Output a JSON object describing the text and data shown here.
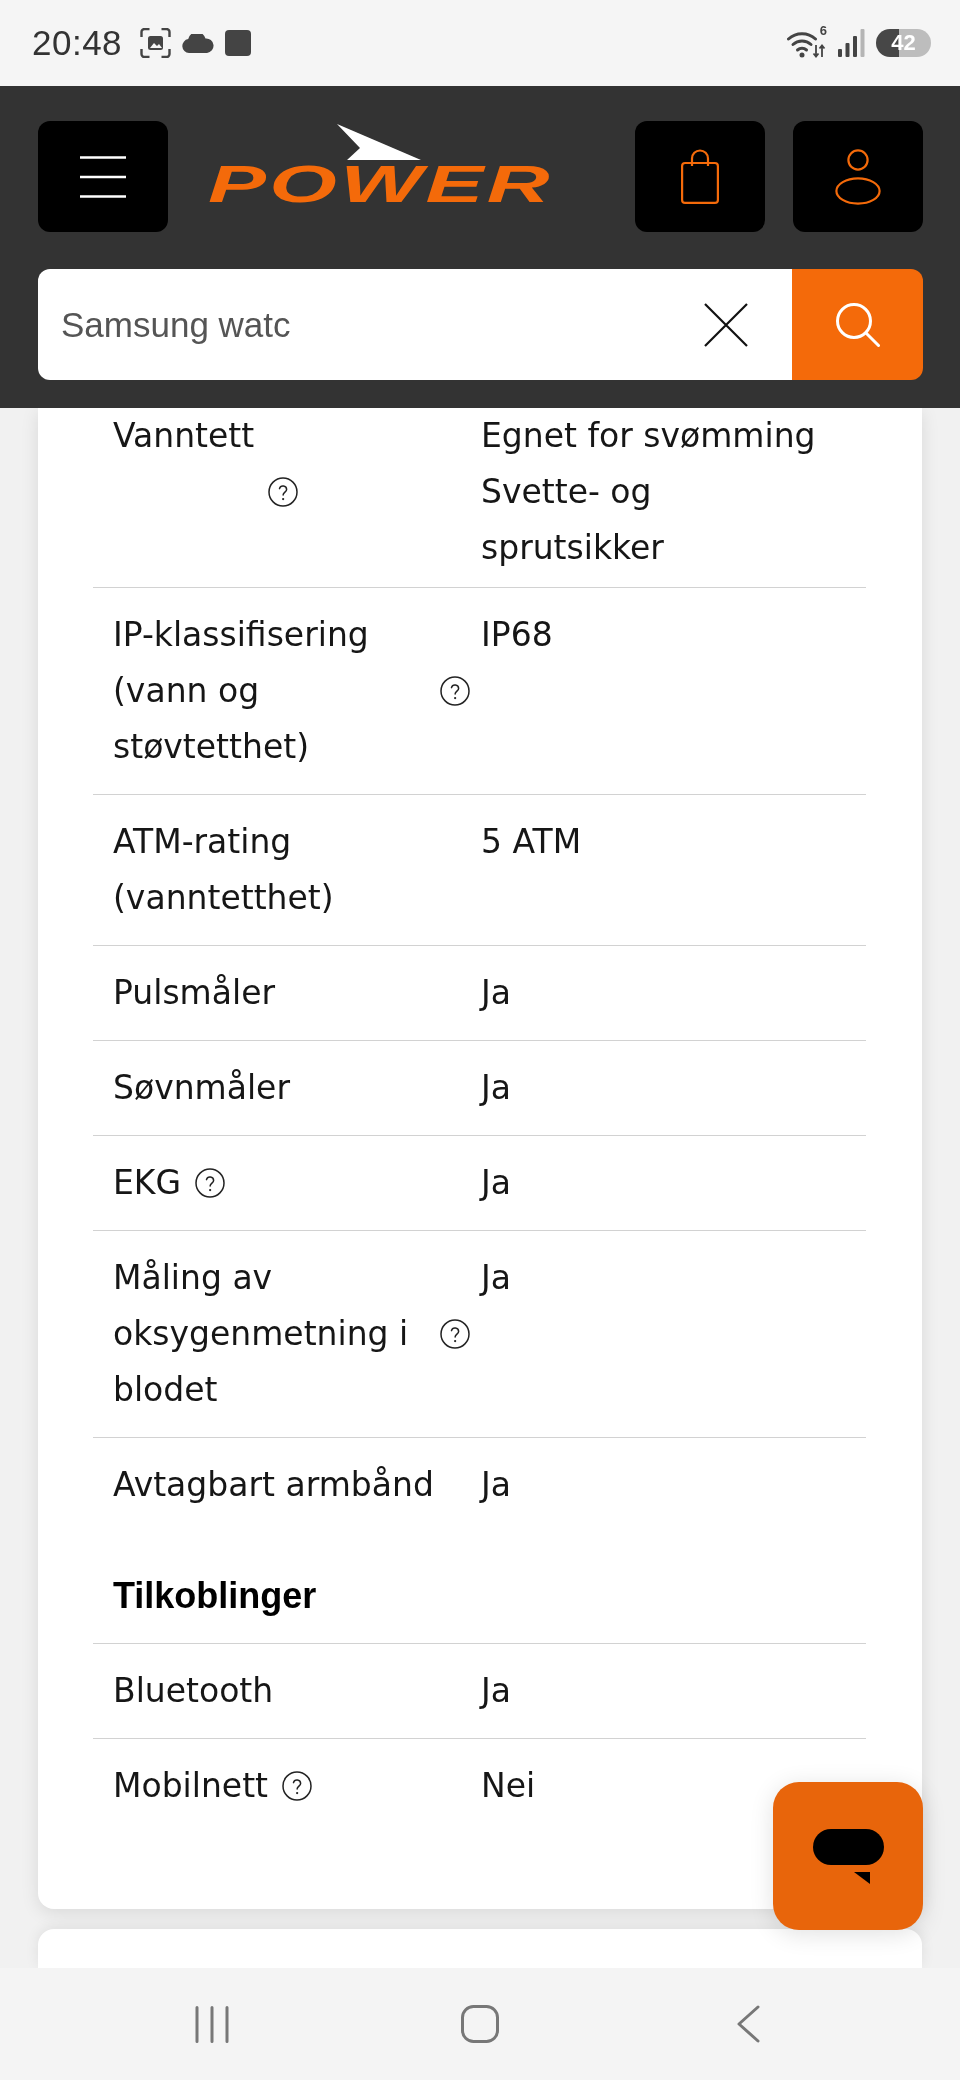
{
  "status_bar": {
    "time": "20:48",
    "wifi_badge": "6",
    "battery": "42"
  },
  "header": {
    "logo": "POWER",
    "search": {
      "value": "Samsung watc"
    }
  },
  "specs": [
    {
      "rows": [
        {
          "label": "Vanntett",
          "help": true,
          "values": [
            "Egnet for svømming",
            "Svette- og sprutsikker"
          ]
        },
        {
          "label": "IP-klassifisering (vann og støvtetthet)",
          "help": true,
          "values": [
            "IP68"
          ]
        },
        {
          "label": "ATM-rating (vanntetthet)",
          "help": false,
          "values": [
            "5 ATM"
          ]
        },
        {
          "label": "Pulsmåler",
          "help": false,
          "values": [
            "Ja"
          ]
        },
        {
          "label": "Søvnmåler",
          "help": false,
          "values": [
            "Ja"
          ]
        },
        {
          "label": "EKG",
          "help": true,
          "values": [
            "Ja"
          ]
        },
        {
          "label": "Måling av oksygenmetning i blodet",
          "help": true,
          "values": [
            "Ja"
          ]
        },
        {
          "label": "Avtagbart armbånd",
          "help": false,
          "values": [
            "Ja"
          ]
        }
      ]
    },
    {
      "heading": "Tilkoblinger",
      "rows": [
        {
          "label": "Bluetooth",
          "help": false,
          "values": [
            "Ja"
          ]
        },
        {
          "label": "Mobilnett",
          "help": true,
          "values": [
            "Nei"
          ]
        }
      ]
    }
  ]
}
